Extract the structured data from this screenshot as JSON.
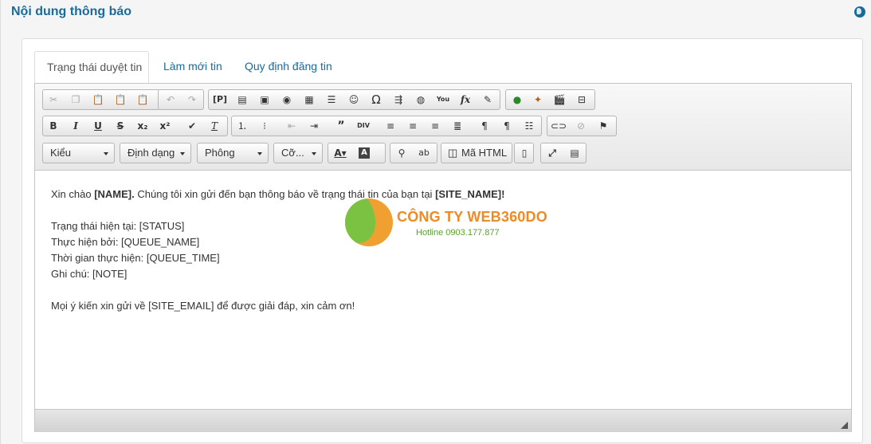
{
  "header": {
    "title": "Nội dung thông báo",
    "globe_icon": "globe-icon"
  },
  "tabs": [
    {
      "label": "Trạng thái duyệt tin",
      "active": true
    },
    {
      "label": "Làm mới tin",
      "active": false
    },
    {
      "label": "Quy định đăng tin",
      "active": false
    }
  ],
  "toolbar": {
    "row1": {
      "clipboard": [
        "cut-icon",
        "copy-icon",
        "paste-icon",
        "paste-text-icon",
        "paste-word-icon"
      ],
      "history": [
        "undo-icon",
        "redo-icon"
      ],
      "insert": [
        "page-break-icon",
        "templates-icon",
        "image-icon",
        "flash-icon",
        "table-icon",
        "horizontal-rule-icon",
        "smiley-icon",
        "special-char-icon",
        "iframe-icon",
        "globe-link-icon",
        "youtube-icon",
        "formula-icon",
        "select-all-icon"
      ],
      "extras": [
        "map-icon",
        "plugin-icon",
        "video-icon",
        "minus-icon"
      ]
    },
    "row2": {
      "basic": [
        "bold-icon",
        "italic-icon",
        "underline-icon",
        "strike-icon",
        "subscript-icon",
        "superscript-icon",
        "format-painter-icon",
        "remove-format-icon"
      ],
      "list": [
        "numbered-list-icon",
        "bulleted-list-icon",
        "outdent-icon",
        "indent-icon",
        "blockquote-icon",
        "div-icon",
        "align-left-icon",
        "align-center-icon",
        "align-right-icon",
        "justify-icon",
        "ltr-icon",
        "rtl-icon",
        "language-icon"
      ],
      "links": [
        "link-icon",
        "unlink-icon",
        "anchor-icon"
      ]
    },
    "row3": {
      "styles_label": "Kiểu",
      "format_label": "Định dạng",
      "font_label": "Phông",
      "size_label": "Cỡ...",
      "source_label": "Mã HTML"
    }
  },
  "content": {
    "greeting_pre": "Xin chào ",
    "name_token": "[NAME].",
    "greeting_mid": " Chúng tôi xin gửi đến bạn thông báo về trạng thái tin của bạn tại ",
    "site_token": "[SITE_NAME]!",
    "status_line": "Trạng thái hiện tại: [STATUS]",
    "queue_line": "Thực hiện bởi: [QUEUE_NAME]",
    "time_line": "Thời gian thực hiện: [QUEUE_TIME]",
    "note_line": "Ghi chú: [NOTE]",
    "closing_line": "Mọi ý kiến xin gửi về [SITE_EMAIL] để được giải đáp, xin cảm ơn!"
  },
  "watermark": {
    "name": "CÔNG TY WEB360DO",
    "hotline": "Hotline 0903.177.877"
  }
}
